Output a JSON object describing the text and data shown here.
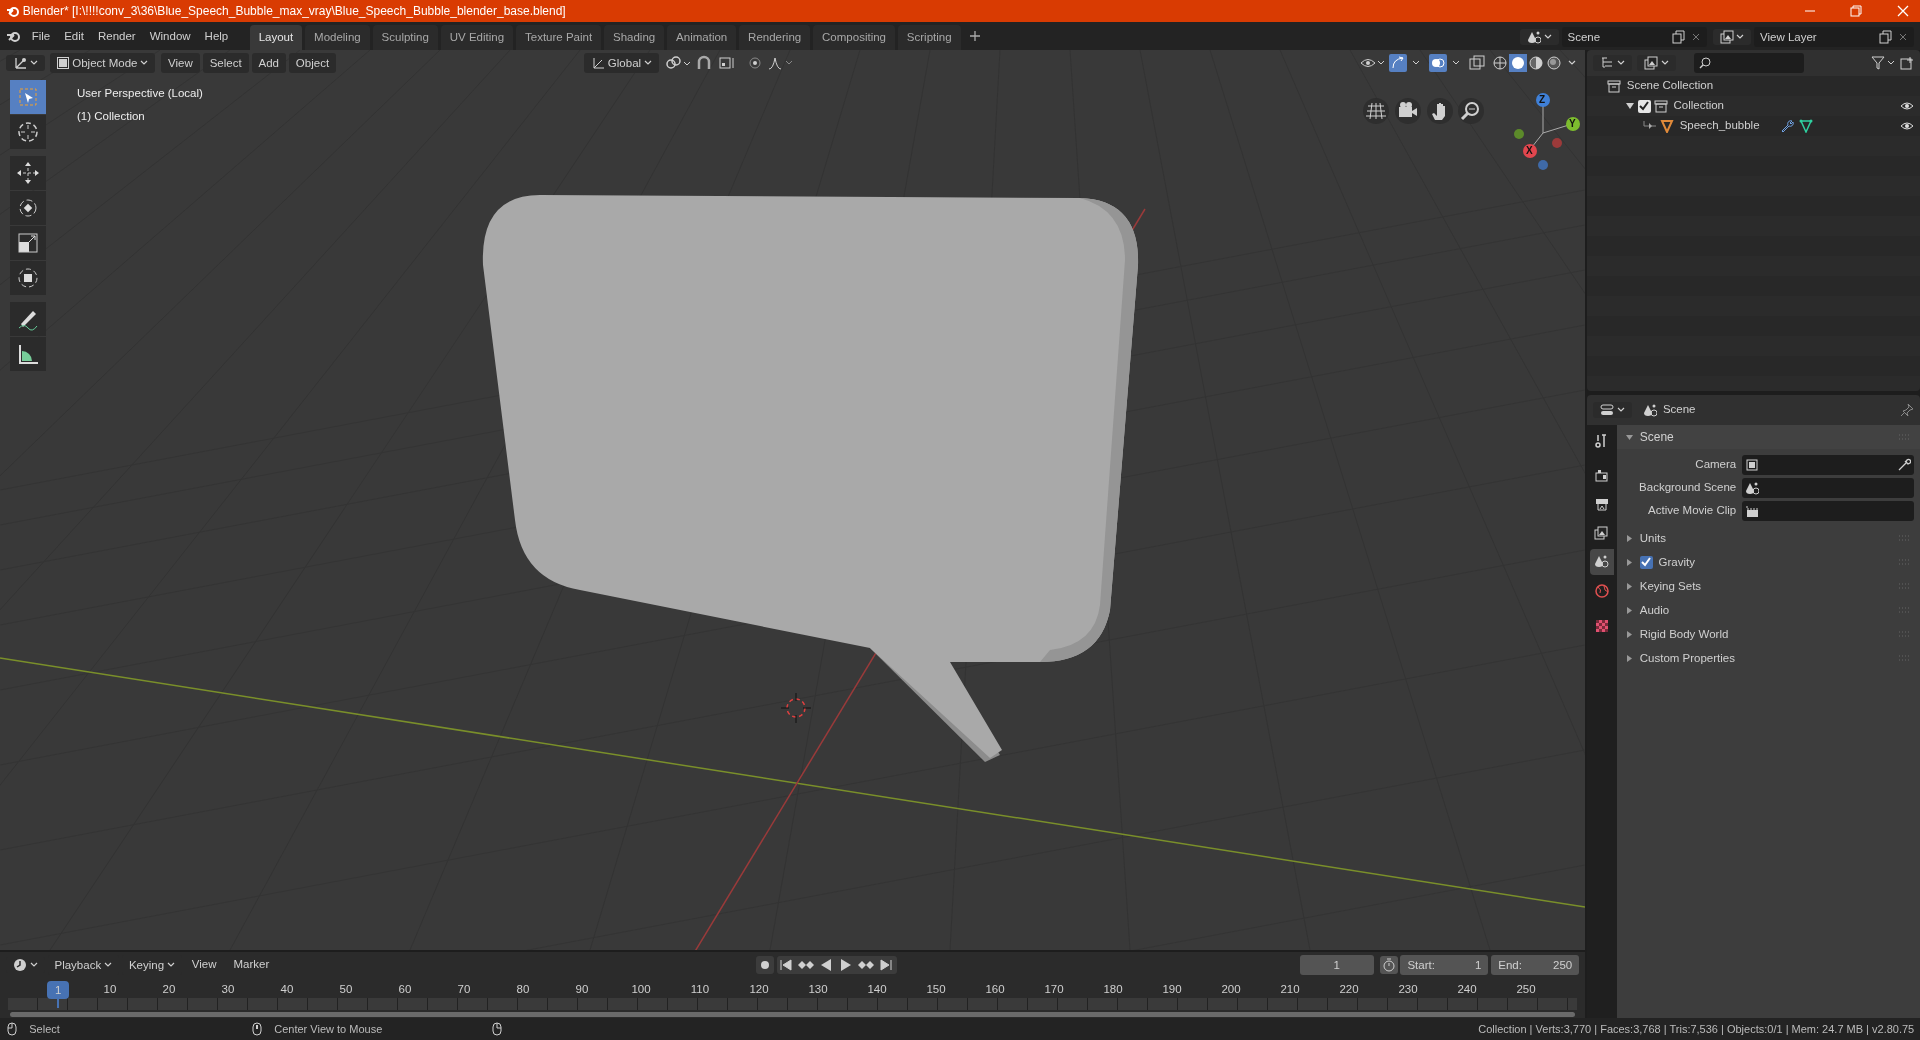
{
  "window": {
    "title": "Blender* [I:\\!!!!conv_3\\36\\Blue_Speech_Bubble_max_vray\\Blue_Speech_Bubble_blender_base.blend]"
  },
  "menu": [
    "File",
    "Edit",
    "Render",
    "Window",
    "Help"
  ],
  "workspaces": [
    {
      "label": "Layout",
      "selected": true
    },
    {
      "label": "Modeling",
      "selected": false
    },
    {
      "label": "Sculpting",
      "selected": false
    },
    {
      "label": "UV Editing",
      "selected": false
    },
    {
      "label": "Texture Paint",
      "selected": false
    },
    {
      "label": "Shading",
      "selected": false
    },
    {
      "label": "Animation",
      "selected": false
    },
    {
      "label": "Rendering",
      "selected": false
    },
    {
      "label": "Compositing",
      "selected": false
    },
    {
      "label": "Scripting",
      "selected": false
    }
  ],
  "scene_field": "Scene",
  "view_layer_field": "View Layer",
  "viewport": {
    "mode": "Object Mode",
    "menus": [
      "View",
      "Select",
      "Add",
      "Object"
    ],
    "orientation": "Global",
    "tools": [
      {
        "kind": "select",
        "selected": true
      },
      {
        "kind": "cursor",
        "selected": false
      },
      {
        "kind": "move",
        "selected": false
      },
      {
        "kind": "rotate",
        "selected": false
      },
      {
        "kind": "scale",
        "selected": false
      },
      {
        "kind": "transform",
        "selected": false
      },
      {
        "kind": "annotate",
        "selected": false
      },
      {
        "kind": "measure",
        "selected": false
      }
    ],
    "overlay_text": [
      "User Perspective (Local)",
      "(1) Collection"
    ],
    "gizmo": {
      "x": "X",
      "y": "Y",
      "z": "Z"
    }
  },
  "outliner": {
    "items": [
      {
        "label": "Scene Collection",
        "children": [
          {
            "label": "Collection",
            "checked": true,
            "expanded": true,
            "children": [
              {
                "label": "Speech_bubble"
              }
            ]
          }
        ]
      }
    ]
  },
  "properties": {
    "header": "Scene",
    "tabs": [
      {
        "kind": "tool",
        "selected": false
      },
      {
        "kind": "render",
        "selected": false
      },
      {
        "kind": "output",
        "selected": false
      },
      {
        "kind": "view_layer",
        "selected": false
      },
      {
        "kind": "scene",
        "selected": true
      },
      {
        "kind": "world",
        "selected": false
      },
      {
        "kind": "texture",
        "selected": false
      }
    ],
    "sections": [
      {
        "label": "Scene",
        "expanded": true,
        "fields": [
          {
            "label": "Camera",
            "kind": "camera"
          },
          {
            "label": "Background Scene",
            "kind": "scene"
          },
          {
            "label": "Active Movie Clip",
            "kind": "clip"
          }
        ]
      },
      {
        "label": "Units",
        "expanded": false
      },
      {
        "label": "Gravity",
        "expanded": false,
        "checked": true
      },
      {
        "label": "Keying Sets",
        "expanded": false
      },
      {
        "label": "Audio",
        "expanded": false
      },
      {
        "label": "Rigid Body World",
        "expanded": false
      },
      {
        "label": "Custom Properties",
        "expanded": false
      }
    ]
  },
  "timeline": {
    "menus": [
      "Playback",
      "Keying",
      "View",
      "Marker"
    ],
    "current_frame": "1",
    "start_label": "Start:",
    "start": "1",
    "end_label": "End:",
    "end": "250",
    "playhead": "1",
    "ruler": [
      "10",
      "20",
      "30",
      "40",
      "50",
      "60",
      "70",
      "80",
      "90",
      "100",
      "110",
      "120",
      "130",
      "140",
      "150",
      "160",
      "170",
      "180",
      "190",
      "200",
      "210",
      "220",
      "230",
      "240",
      "250"
    ]
  },
  "status_bar": {
    "left": [
      "Select",
      "Center View to Mouse"
    ],
    "right": "Collection | Verts:3,770 | Faces:3,768 | Tris:7,536 | Objects:0/1 | Mem: 24.7 MB | v2.80.75"
  }
}
